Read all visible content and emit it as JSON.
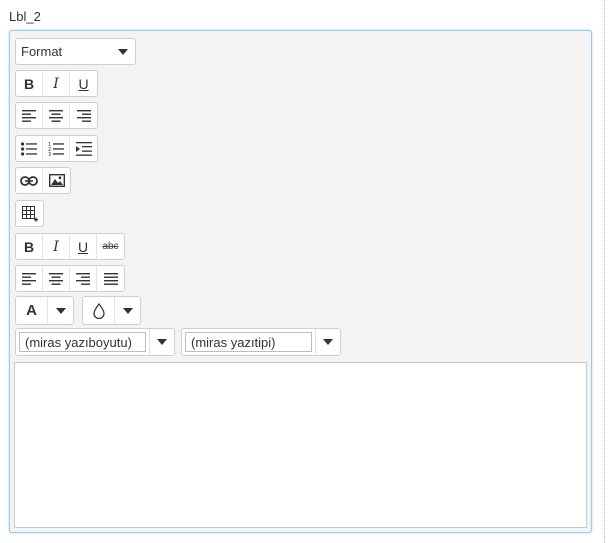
{
  "field": {
    "label": "Lbl_2"
  },
  "toolbar": {
    "format": {
      "value": "Format"
    },
    "basic_styles": {
      "bold": "B",
      "italic": "I",
      "underline": "U"
    },
    "styles2": {
      "bold": "B",
      "italic": "I",
      "underline": "U",
      "strike": "abc"
    },
    "font_color": {
      "glyph": "A"
    },
    "font_size": {
      "value": "(miras yazıboyutu)"
    },
    "font_family": {
      "value": "(miras yazıtipi)"
    }
  },
  "colors": {
    "border_focus": "#9ecae6",
    "toolbar_bg": "#f3f3f3"
  }
}
